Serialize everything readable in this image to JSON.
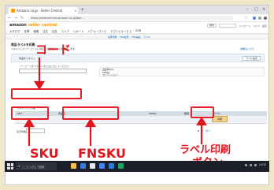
{
  "browser": {
    "tab_title": "Amazon.co.jp - Seller Central",
    "url": "https://sellercentral.amazon.co.jp/fba/...",
    "new_tab_symbol": "+",
    "close_symbol": "×",
    "window_controls": [
      "–",
      "□",
      "×"
    ],
    "nav_icons": [
      "←",
      "→",
      "↻"
    ]
  },
  "header": {
    "logo": "amazon",
    "logo_suffix": "seller central",
    "menu": [
      "カタログ",
      "在庫",
      "価格",
      "注文",
      "広告",
      "ストア",
      "レポート",
      "パフォーマンス",
      "アプリとサービス",
      "B2B"
    ],
    "search_pill": "検索",
    "links": [
      "メッセージ",
      "ヘルプ",
      "設定"
    ]
  },
  "subnav": [
    "在庫管理",
    "FBA在庫",
    "FBA納品",
    "ラベル"
  ],
  "page": {
    "title": "商品ラベルを印刷",
    "description": "スキャンしたバーコードに対応する商品ラベルを印刷します。",
    "description_link": "詳細はこちら",
    "panel_label": "商品をスキャン",
    "panel_button": "ラベル設定",
    "field_label": "バーコードをスキャンまたは入力してください",
    "scan_value": "",
    "info_lines": [
      "出品者SKU:",
      "FNSKU:",
      "コンディション:"
    ],
    "table_caption": "スキャンした商品",
    "columns": [
      "SKU",
      "商品名",
      "FNSKU",
      "数量",
      "ラベル"
    ],
    "row": {
      "sku": "",
      "title": "",
      "fnsku": "",
      "qty": "",
      "print_label": "印刷"
    },
    "pager_label": "表示件数",
    "pager_numbers": [
      "1",
      "2",
      "次へ"
    ]
  },
  "annotations": {
    "code": "コード",
    "sku": "SKU",
    "fnsku": "FNSKU",
    "label_line1": "ラベル印刷",
    "label_line2": "ボタン",
    "color": "#e3141c"
  },
  "taskbar": {
    "search_placeholder": "ここに入力して検索",
    "clock": "14:32"
  }
}
